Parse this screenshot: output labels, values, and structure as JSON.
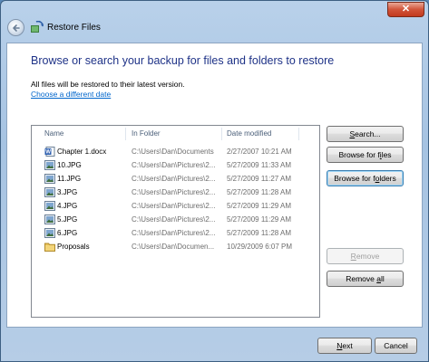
{
  "window": {
    "title": "Restore Files",
    "close_glyph": "✕"
  },
  "header": {
    "heading": "Browse or search your backup for files and folders to restore",
    "subtext": "All files will be restored to their latest version.",
    "choose_link": "Choose a different date"
  },
  "list": {
    "columns": [
      "Name",
      "In Folder",
      "Date modified"
    ],
    "rows": [
      {
        "name": "Chapter 1.docx",
        "folder": "C:\\Users\\Dan\\Documents",
        "date": "2/27/2007 10:21 AM",
        "icon": "word-document-icon"
      },
      {
        "name": "10.JPG",
        "folder": "C:\\Users\\Dan\\Pictures\\2...",
        "date": "5/27/2009 11:33 AM",
        "icon": "image-file-icon"
      },
      {
        "name": "11.JPG",
        "folder": "C:\\Users\\Dan\\Pictures\\2...",
        "date": "5/27/2009 11:27 AM",
        "icon": "image-file-icon"
      },
      {
        "name": "3.JPG",
        "folder": "C:\\Users\\Dan\\Pictures\\2...",
        "date": "5/27/2009 11:28 AM",
        "icon": "image-file-icon"
      },
      {
        "name": "4.JPG",
        "folder": "C:\\Users\\Dan\\Pictures\\2...",
        "date": "5/27/2009 11:29 AM",
        "icon": "image-file-icon"
      },
      {
        "name": "5.JPG",
        "folder": "C:\\Users\\Dan\\Pictures\\2...",
        "date": "5/27/2009 11:29 AM",
        "icon": "image-file-icon"
      },
      {
        "name": "6.JPG",
        "folder": "C:\\Users\\Dan\\Pictures\\2...",
        "date": "5/27/2009 11:28 AM",
        "icon": "image-file-icon"
      },
      {
        "name": "Proposals",
        "folder": "C:\\Users\\Dan\\Documen...",
        "date": "10/29/2009 6:07 PM",
        "icon": "folder-icon"
      }
    ]
  },
  "buttons": {
    "search": {
      "pre": "",
      "key": "S",
      "post": "earch..."
    },
    "browse_files": {
      "pre": "Browse for f",
      "key": "i",
      "post": "les"
    },
    "browse_folders": {
      "pre": "Browse for f",
      "key": "o",
      "post": "lders"
    },
    "remove": {
      "pre": "",
      "key": "R",
      "post": "emove"
    },
    "remove_all": {
      "pre": "Remove ",
      "key": "a",
      "post": "ll"
    },
    "next": {
      "pre": "",
      "key": "N",
      "post": "ext"
    },
    "cancel": {
      "pre": "Cancel",
      "key": "",
      "post": ""
    }
  },
  "colors": {
    "heading": "#1e3287",
    "link": "#0066cc",
    "close": "#c23a1e"
  }
}
